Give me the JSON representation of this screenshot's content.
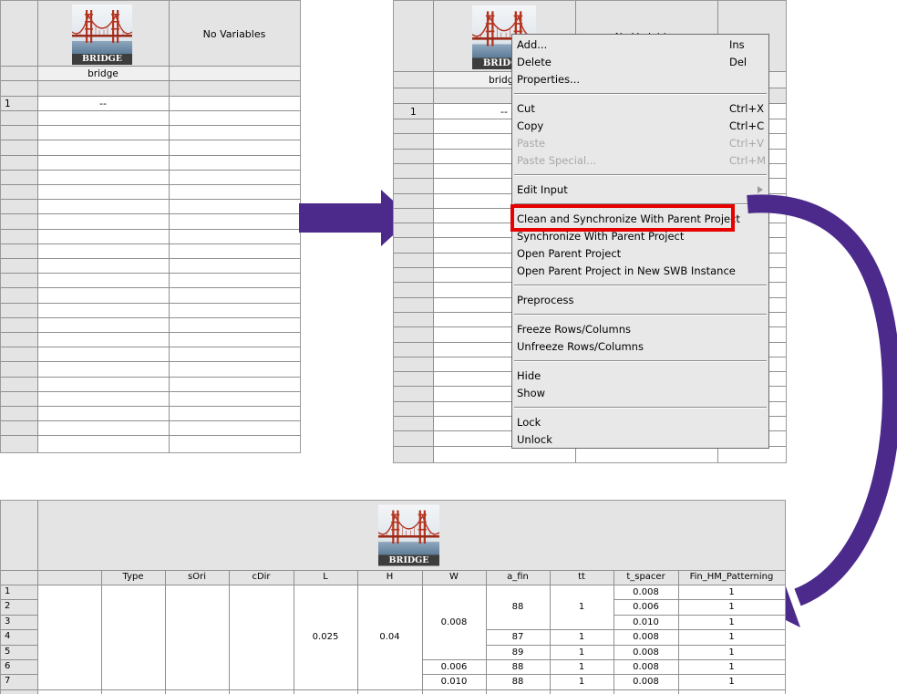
{
  "bridge_icon": {
    "label": "BRIDGE"
  },
  "initial_table": {
    "no_variables": "No Variables",
    "tool_name": "bridge",
    "row_number": "1",
    "cell_value": "--"
  },
  "context_menu": {
    "groups": [
      [
        {
          "label": "Add...",
          "shortcut": "Ins",
          "disabled": false
        },
        {
          "label": "Delete",
          "shortcut": "Del",
          "disabled": false
        },
        {
          "label": "Properties...",
          "shortcut": "",
          "disabled": false
        }
      ],
      [
        {
          "label": "Cut",
          "shortcut": "Ctrl+X",
          "disabled": false
        },
        {
          "label": "Copy",
          "shortcut": "Ctrl+C",
          "disabled": false
        },
        {
          "label": "Paste",
          "shortcut": "Ctrl+V",
          "disabled": true
        },
        {
          "label": "Paste Special...",
          "shortcut": "Ctrl+M",
          "disabled": true
        }
      ],
      [
        {
          "label": "Edit Input",
          "shortcut": "",
          "disabled": false,
          "submenu": true
        }
      ],
      [
        {
          "label": "Clean and Synchronize With Parent Project",
          "shortcut": "",
          "disabled": false,
          "highlighted": true
        },
        {
          "label": "Synchronize With Parent Project",
          "shortcut": "",
          "disabled": false
        },
        {
          "label": "Open Parent Project",
          "shortcut": "",
          "disabled": false
        },
        {
          "label": "Open Parent Project in New SWB Instance",
          "shortcut": "",
          "disabled": false
        }
      ],
      [
        {
          "label": "Preprocess",
          "shortcut": "",
          "disabled": false
        }
      ],
      [
        {
          "label": "Freeze Rows/Columns",
          "shortcut": "",
          "disabled": false
        },
        {
          "label": "Unfreeze Rows/Columns",
          "shortcut": "",
          "disabled": false
        }
      ],
      [
        {
          "label": "Hide",
          "shortcut": "",
          "disabled": false
        },
        {
          "label": "Show",
          "shortcut": "",
          "disabled": false
        }
      ],
      [
        {
          "label": "Lock",
          "shortcut": "",
          "disabled": false
        },
        {
          "label": "Unlock",
          "shortcut": "",
          "disabled": false
        }
      ]
    ],
    "highlight_color": "#e60000"
  },
  "result_table": {
    "headers": [
      "Type",
      "sOri",
      "cDir",
      "L",
      "H",
      "W",
      "a_fin",
      "tt",
      "t_spacer",
      "Fin_HM_Patterning"
    ],
    "row_numbers": [
      "1",
      "2",
      "3",
      "4",
      "5",
      "6",
      "7"
    ],
    "merged_values": {
      "L": "0.025",
      "H": "0.04",
      "W_rows_1_5": "0.008",
      "a_fin_rows_1_3": "88",
      "tt_rows_1_3": "1"
    },
    "rows": [
      {
        "W": "",
        "a_fin": "",
        "tt": "",
        "t_spacer": "0.008",
        "fin": "1"
      },
      {
        "W": "",
        "a_fin": "",
        "tt": "",
        "t_spacer": "0.006",
        "fin": "1"
      },
      {
        "W": "",
        "a_fin": "",
        "tt": "",
        "t_spacer": "0.010",
        "fin": "1"
      },
      {
        "W": "",
        "a_fin": "87",
        "tt": "1",
        "t_spacer": "0.008",
        "fin": "1"
      },
      {
        "W": "",
        "a_fin": "89",
        "tt": "1",
        "t_spacer": "0.008",
        "fin": "1"
      },
      {
        "W": "0.006",
        "a_fin": "88",
        "tt": "1",
        "t_spacer": "0.008",
        "fin": "1"
      },
      {
        "W": "0.010",
        "a_fin": "88",
        "tt": "1",
        "t_spacer": "0.008",
        "fin": "1"
      }
    ]
  },
  "colors": {
    "arrow": "#4b2a8c",
    "header_bg": "#e4e4e4",
    "grid_line": "#8f8f8f",
    "menu_bg": "#e8e8e8"
  }
}
